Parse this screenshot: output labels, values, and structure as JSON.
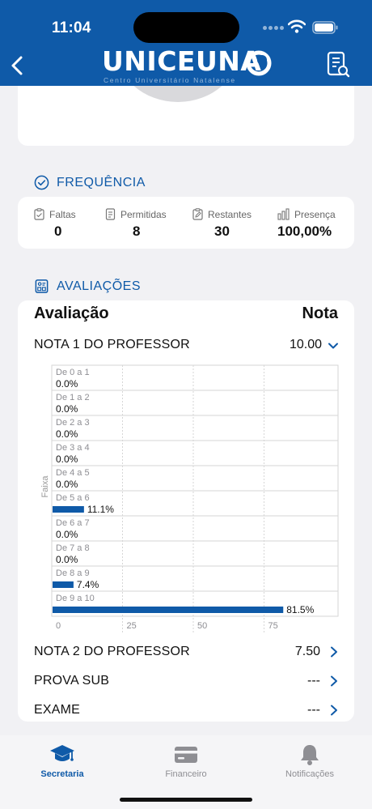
{
  "status_bar": {
    "time": "11:04"
  },
  "header": {
    "logo_text": "UNICEUNA",
    "logo_tagline": "Centro Universitário Natalense"
  },
  "frequencia": {
    "title": "FREQUÊNCIA",
    "stats": [
      {
        "label": "Faltas",
        "value": "0"
      },
      {
        "label": "Permitidas",
        "value": "8"
      },
      {
        "label": "Restantes",
        "value": "30"
      },
      {
        "label": "Presença",
        "value": "100,00%"
      }
    ]
  },
  "avaliacoes": {
    "title": "AVALIAÇÕES",
    "col_avaliacao": "Avaliação",
    "col_nota": "Nota",
    "rows": [
      {
        "label": "NOTA 1 DO PROFESSOR",
        "value": "10.00",
        "expanded": true
      },
      {
        "label": "NOTA 2 DO PROFESSOR",
        "value": "7.50",
        "expanded": false
      },
      {
        "label": "PROVA SUB",
        "value": "---",
        "expanded": false
      },
      {
        "label": "EXAME",
        "value": "---",
        "expanded": false
      }
    ]
  },
  "chart_data": {
    "type": "bar",
    "orientation": "horizontal",
    "ylabel": "Faixa",
    "xlabel": "",
    "xlim": [
      0,
      100
    ],
    "x_ticks": [
      "0",
      "25",
      "50",
      "75"
    ],
    "grid": true,
    "bar_color": "#0f5aa8",
    "categories": [
      "De 0 a 1",
      "De 1 a 2",
      "De 2 a 3",
      "De 3 a 4",
      "De 4 a 5",
      "De 5 a 6",
      "De 6 a 7",
      "De 7 a 8",
      "De 8 a 9",
      "De 9 a 10"
    ],
    "values": [
      0.0,
      0.0,
      0.0,
      0.0,
      0.0,
      11.1,
      0.0,
      0.0,
      7.4,
      81.5
    ],
    "value_labels": [
      "0.0%",
      "0.0%",
      "0.0%",
      "0.0%",
      "0.0%",
      "11.1%",
      "0.0%",
      "0.0%",
      "7.4%",
      "81.5%"
    ]
  },
  "tabbar": {
    "tabs": [
      {
        "label": "Secretaria",
        "icon": "graduation-cap-icon",
        "active": true
      },
      {
        "label": "Financeiro",
        "icon": "credit-card-icon",
        "active": false
      },
      {
        "label": "Notificações",
        "icon": "bell-icon",
        "active": false
      }
    ]
  },
  "colors": {
    "primary": "#0f5aa8",
    "background": "#f1f1f4",
    "card": "#ffffff",
    "inactive": "#8e8e93"
  }
}
